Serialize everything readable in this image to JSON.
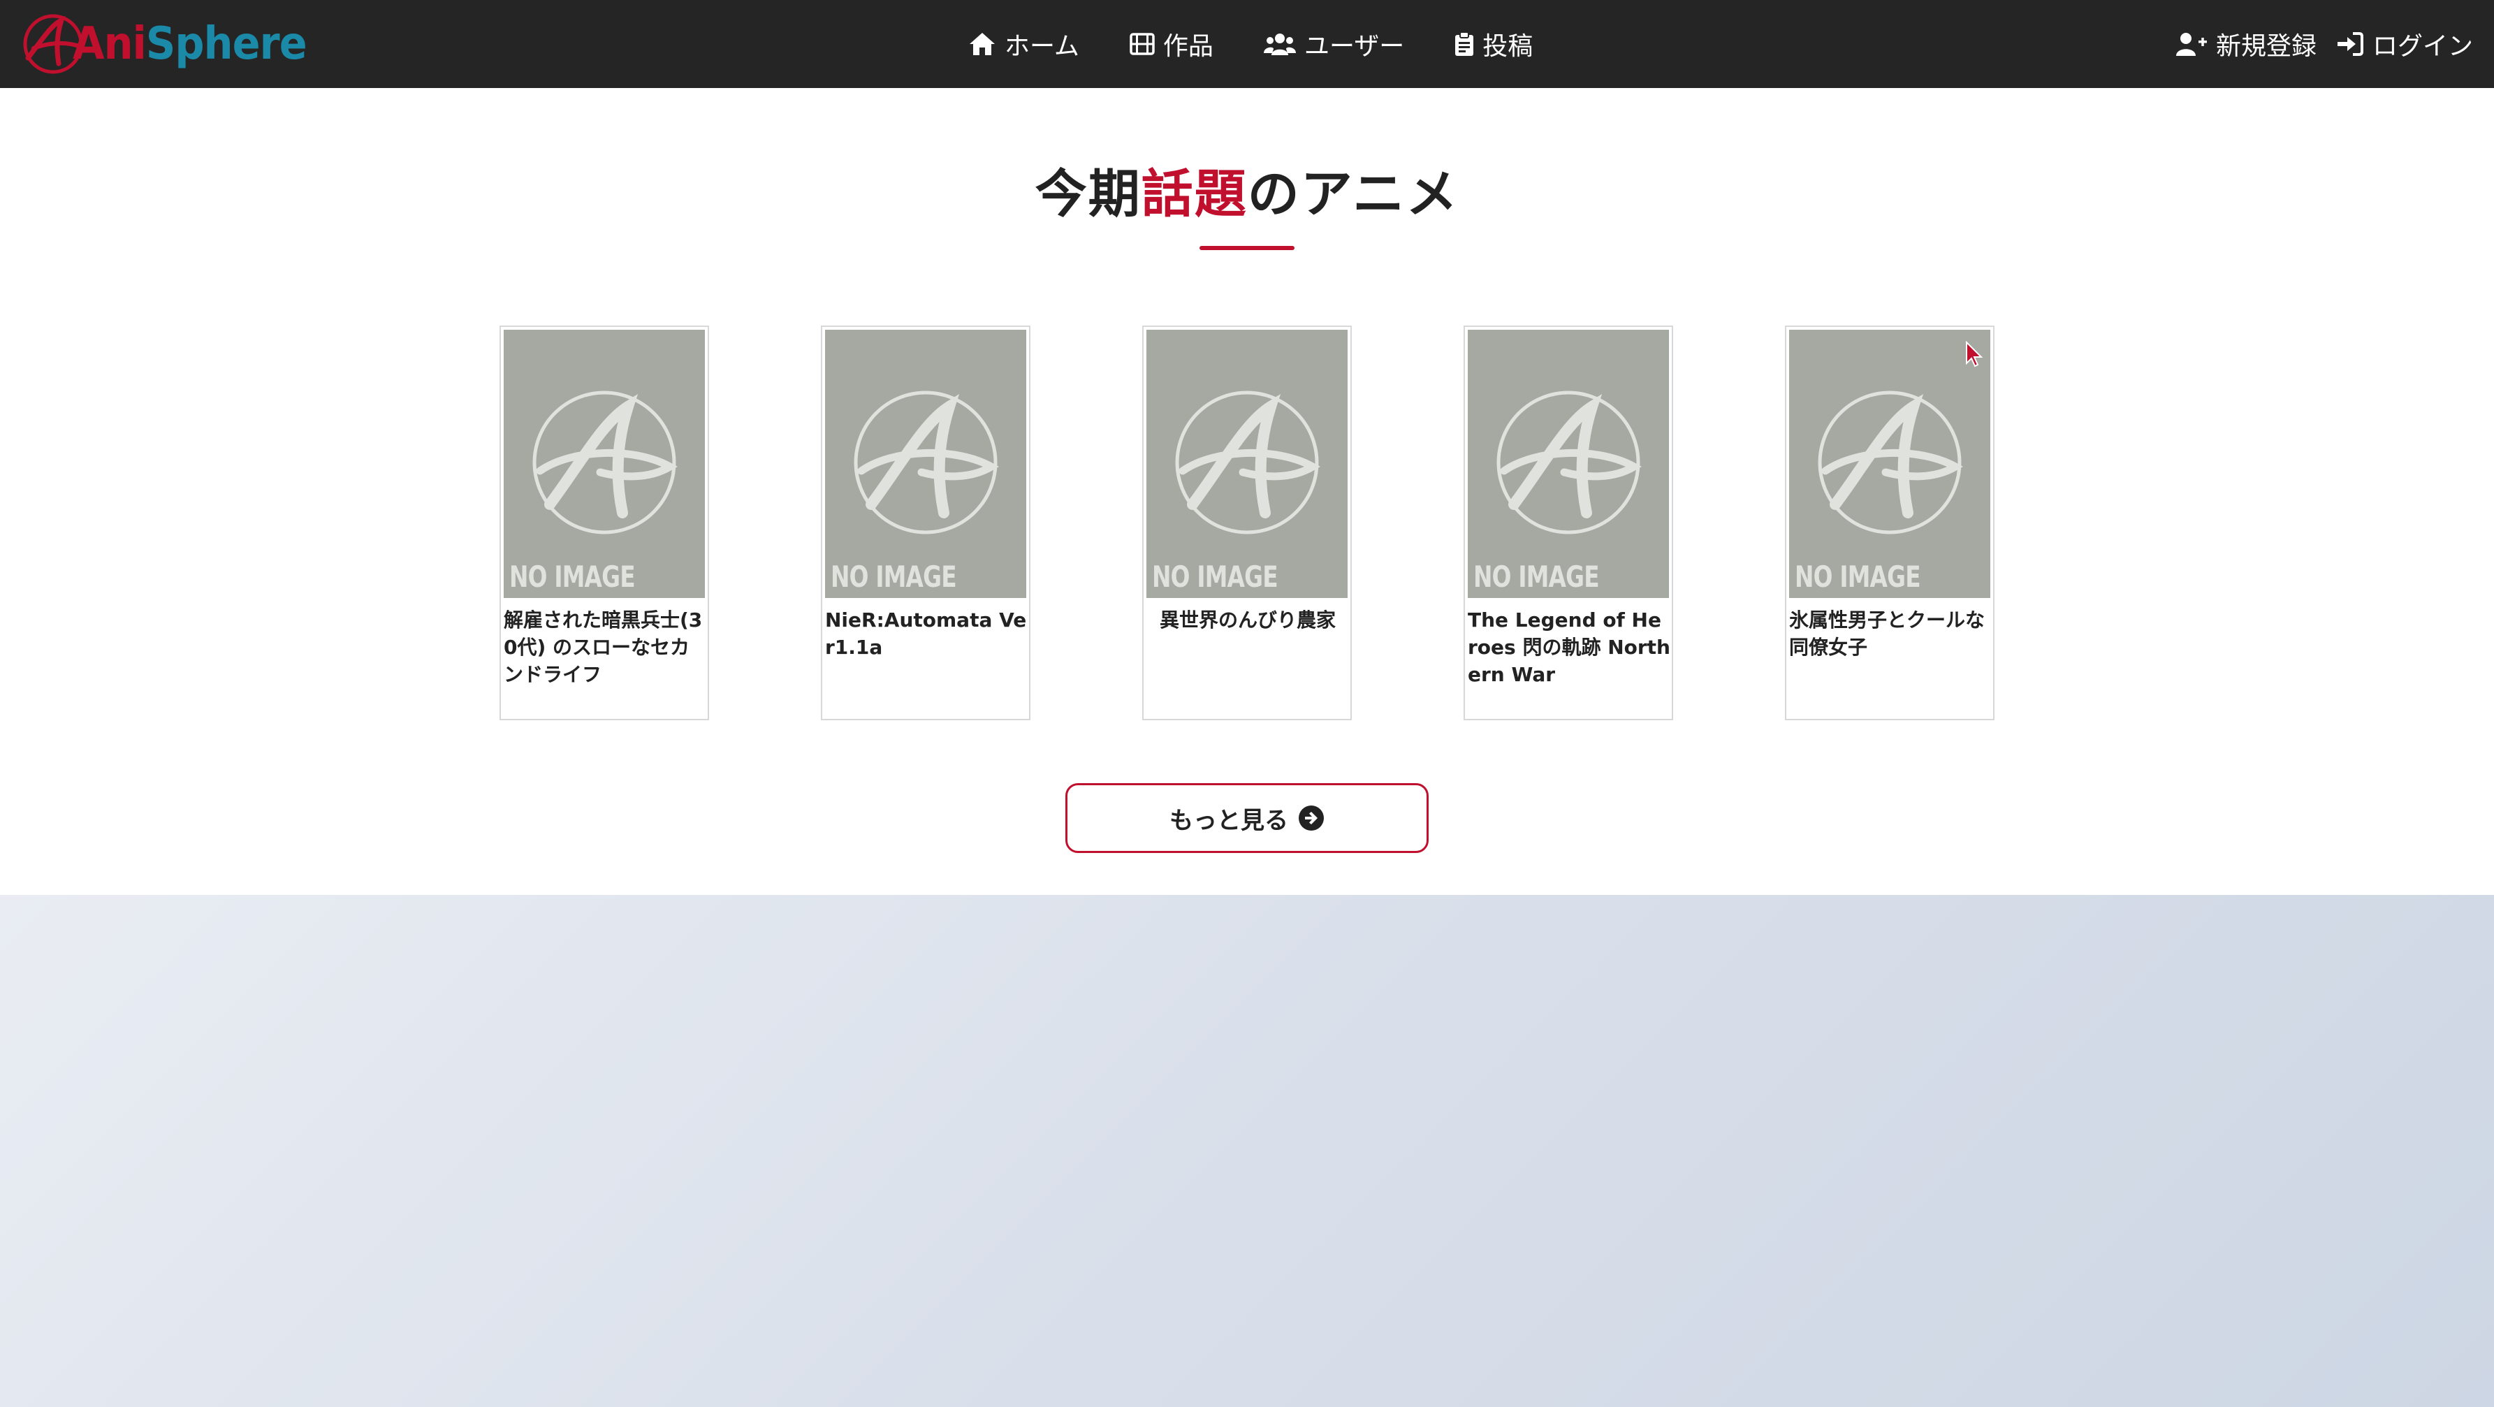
{
  "navbar": {
    "brand": {
      "ani": "Ani",
      "sphere": "Sphere"
    },
    "links": [
      {
        "label": "ホーム",
        "icon": "home-icon"
      },
      {
        "label": "作品",
        "icon": "film-icon"
      },
      {
        "label": "ユーザー",
        "icon": "users-icon"
      },
      {
        "label": "投稿",
        "icon": "clipboard-icon"
      }
    ],
    "right": [
      {
        "label": "新規登録",
        "icon": "user-plus-icon"
      },
      {
        "label": "ログイン",
        "icon": "sign-in-icon"
      }
    ]
  },
  "section": {
    "title_pre": "今期",
    "title_highlight": "話題",
    "title_post": "のアニメ",
    "cards": [
      {
        "title": "解雇された暗黒兵士(30代) のスローなセカンドライフ",
        "image_text": "NO IMAGE"
      },
      {
        "title": "NieR:Automata Ver1.1a",
        "image_text": "NO IMAGE"
      },
      {
        "title": "異世界のんびり農家",
        "image_text": "NO IMAGE"
      },
      {
        "title": "The Legend of Heroes 閃の軌跡 Northern War",
        "image_text": "NO IMAGE"
      },
      {
        "title": "氷属性男子とクールな同僚女子",
        "image_text": "NO IMAGE"
      }
    ],
    "more_button": "もっと見る"
  },
  "colors": {
    "accent": "#c0102e",
    "brand_secondary": "#1a8aa8",
    "navbar_bg": "#252525",
    "placeholder_bg": "#a6a8a2"
  }
}
